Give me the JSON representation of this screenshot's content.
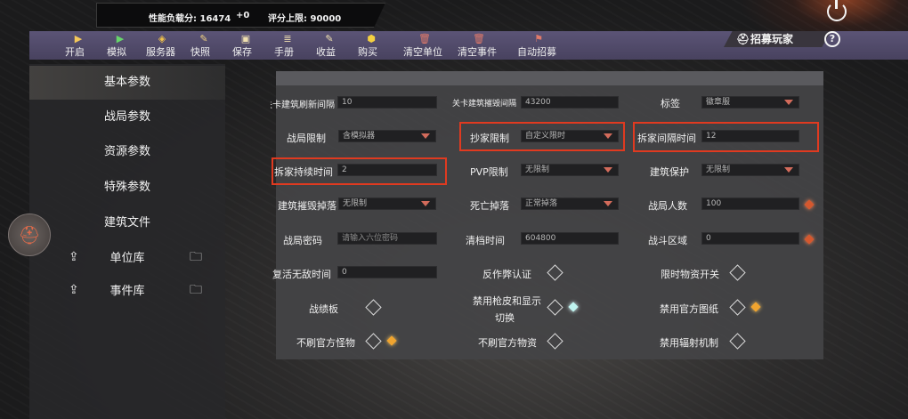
{
  "scorebar": {
    "perf_label": "性能负载分: 16474",
    "delta": "+0",
    "limit_label": "评分上限: 90000"
  },
  "toolbar": {
    "items": [
      {
        "label": "开启",
        "icon": "play-icon"
      },
      {
        "label": "模拟",
        "icon": "play-green-icon"
      },
      {
        "label": "服务器",
        "icon": "server-icon"
      },
      {
        "label": "快照",
        "icon": "edit-icon"
      },
      {
        "label": "保存",
        "icon": "save-icon"
      },
      {
        "label": "手册",
        "icon": "manual-icon"
      },
      {
        "label": "收益",
        "icon": "edit-icon"
      },
      {
        "label": "购买",
        "icon": "buy-icon"
      },
      {
        "label": "清空单位",
        "icon": "trash-icon"
      },
      {
        "label": "清空事件",
        "icon": "trash-icon"
      },
      {
        "label": "自动招募",
        "icon": "flag-icon"
      }
    ],
    "recruit_tab": "招募玩家",
    "help": "?"
  },
  "sidebar": {
    "items": [
      {
        "label": "基本参数"
      },
      {
        "label": "战局参数"
      },
      {
        "label": "资源参数"
      },
      {
        "label": "特殊参数"
      },
      {
        "label": "建筑文件"
      },
      {
        "label": "单位库"
      },
      {
        "label": "事件库"
      }
    ]
  },
  "form": {
    "r1": {
      "a_label": "关卡建筑刷新间隔",
      "a_value": "10",
      "b_label": "关卡建筑摧毁间隔",
      "b_value": "43200",
      "c_label": "标签",
      "c_value": "徽章服"
    },
    "r2": {
      "a_label": "战局限制",
      "a_value": "含模拟器",
      "b_label": "抄家限制",
      "b_value": "自定义限时",
      "c_label": "拆家间隔时间",
      "c_value": "12"
    },
    "r3": {
      "a_label": "拆家持续时间",
      "a_value": "2",
      "b_label": "PVP限制",
      "b_value": "无限制",
      "c_label": "建筑保护",
      "c_value": "无限制"
    },
    "r4": {
      "a_label": "建筑摧毁掉落",
      "a_value": "无限制",
      "b_label": "死亡掉落",
      "b_value": "正常掉落",
      "c_label": "战局人数",
      "c_value": "100"
    },
    "r5": {
      "a_label": "战局密码",
      "a_placeholder": "请输入六位密码",
      "b_label": "清档时间",
      "b_value": "604800",
      "c_label": "战斗区域",
      "c_value": "0"
    },
    "r6": {
      "a_label": "复活无敌时间",
      "a_value": "0",
      "b_label": "反作弊认证",
      "c_label": "限时物资开关"
    },
    "r7": {
      "a_label": "战绩板",
      "b_label_1": "禁用枪皮和显示",
      "b_label_2": "切换",
      "c_label": "禁用官方图纸"
    },
    "r8": {
      "a_label": "不刷官方怪物",
      "b_label": "不刷官方物资",
      "c_label": "禁用辐射机制"
    }
  },
  "colors": {
    "highlight_box": "#e03a20",
    "toolbar_bg": "#524b6b",
    "dropdown_arrow": "#d36b5b"
  }
}
